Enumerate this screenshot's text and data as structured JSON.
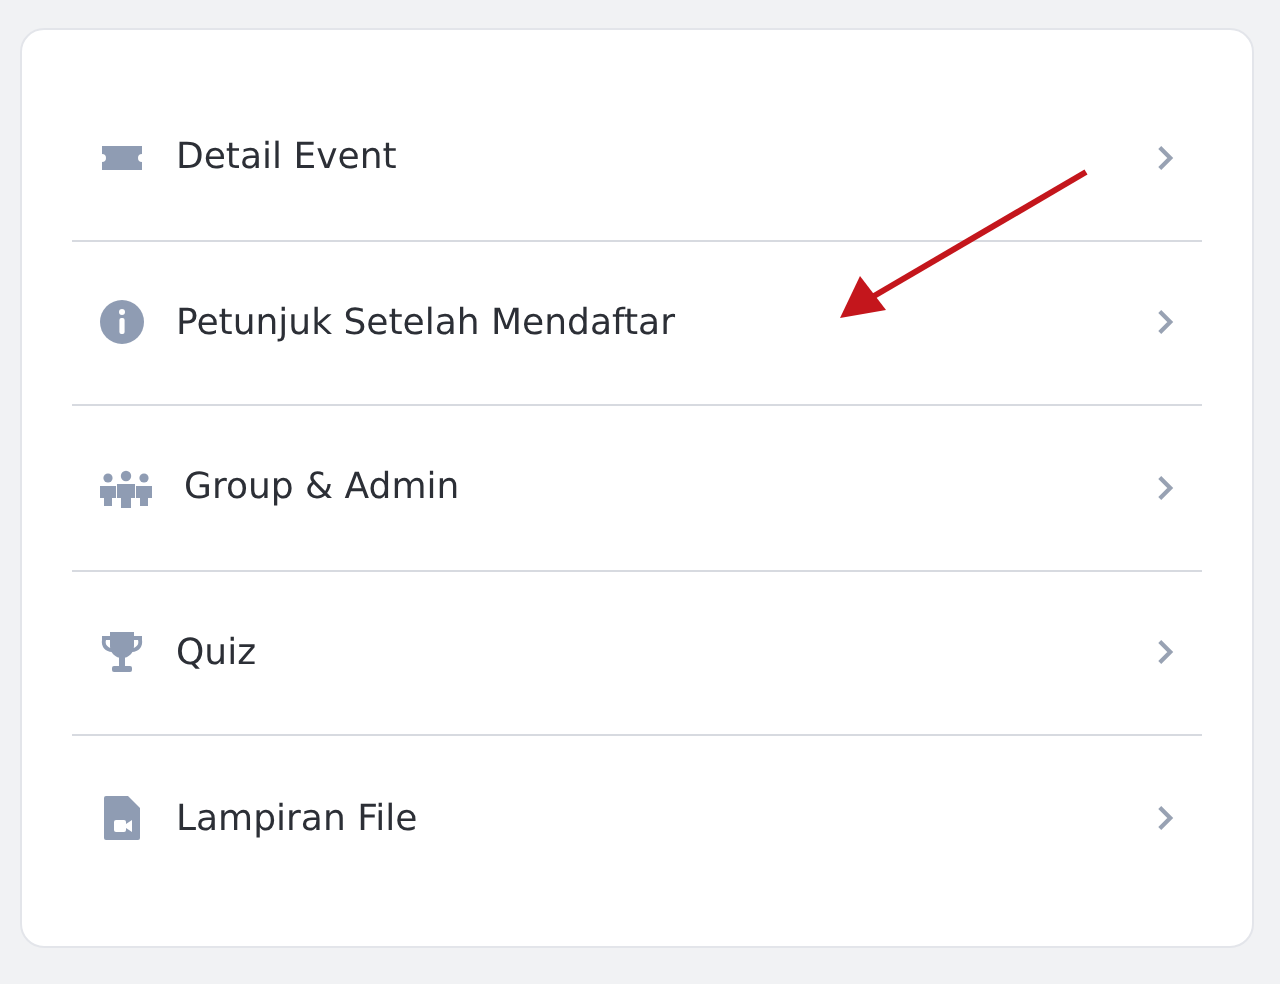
{
  "menu": {
    "items": [
      {
        "label": "Detail Event"
      },
      {
        "label": "Petunjuk Setelah Mendaftar"
      },
      {
        "label": "Group & Admin"
      },
      {
        "label": "Quiz"
      },
      {
        "label": "Lampiran File"
      }
    ]
  }
}
